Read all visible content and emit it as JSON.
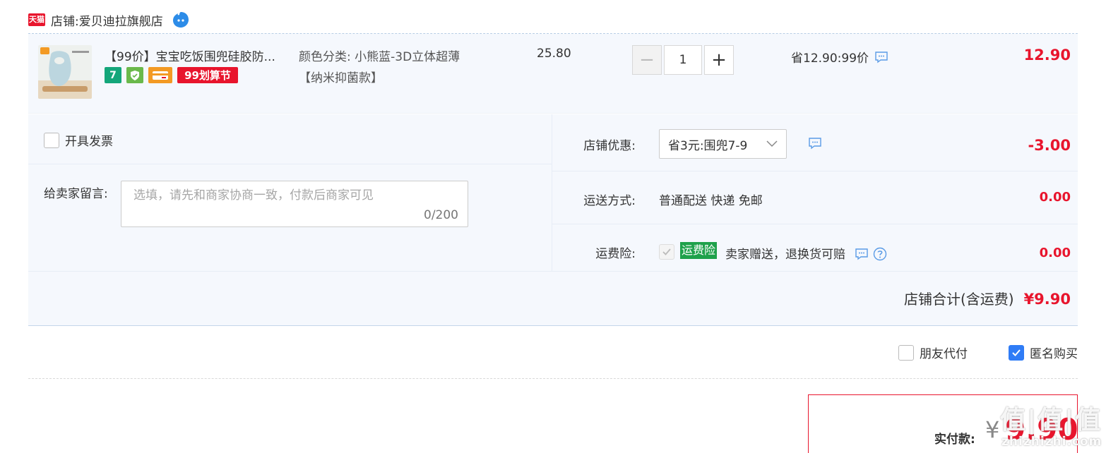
{
  "shop": {
    "badge": "天猫",
    "prefix": "店铺: ",
    "name": "爱贝迪拉旗舰店"
  },
  "item": {
    "title": "【99价】宝宝吃饭围兜硅胶防...",
    "badges": {
      "seven": "7",
      "b99": "99划算节"
    },
    "color_label": "颜色分类: 小熊蓝-3D立体超薄",
    "color_value": "【纳米抑菌款】",
    "unit_price": "25.80",
    "quantity": "1",
    "minus": "−",
    "plus": "+",
    "discount": "省12.90:99价",
    "line_total": "12.90"
  },
  "options": {
    "invoice_label": "开具发票",
    "message_label": "给卖家留言:",
    "message_placeholder": "选填，请先和商家协商一致，付款后商家可见",
    "message_count": "0/200"
  },
  "summary": {
    "coupon_label": "店铺优惠:",
    "coupon_value": "省3元:围兜7-9",
    "coupon_amount": "-3.00",
    "shipping_label": "运送方式:",
    "shipping_value": "普通配送 快递 免邮",
    "shipping_amount": "0.00",
    "insurance_label": "运费险:",
    "insurance_tag": "运费险",
    "insurance_desc": "卖家赠送，退换货可赔",
    "insurance_amount": "0.00",
    "shop_total_label": "店铺合计(含运费)",
    "shop_total_amount": "¥9.90"
  },
  "checkout": {
    "friend_pay": "朋友代付",
    "anonymous": "匿名购买",
    "pay_label": "实付款:",
    "currency": "¥",
    "pay_amount": "9.90",
    "watermark": "值|值|值",
    "watermark_sub": "zhizhizhi.com"
  },
  "colors": {
    "accent_red": "#e8152d",
    "panel_bg": "#f5f8fd",
    "check_blue": "#2f7cf6",
    "insurance_green": "#1fa14b",
    "ww_blue": "#2d8ce8"
  }
}
